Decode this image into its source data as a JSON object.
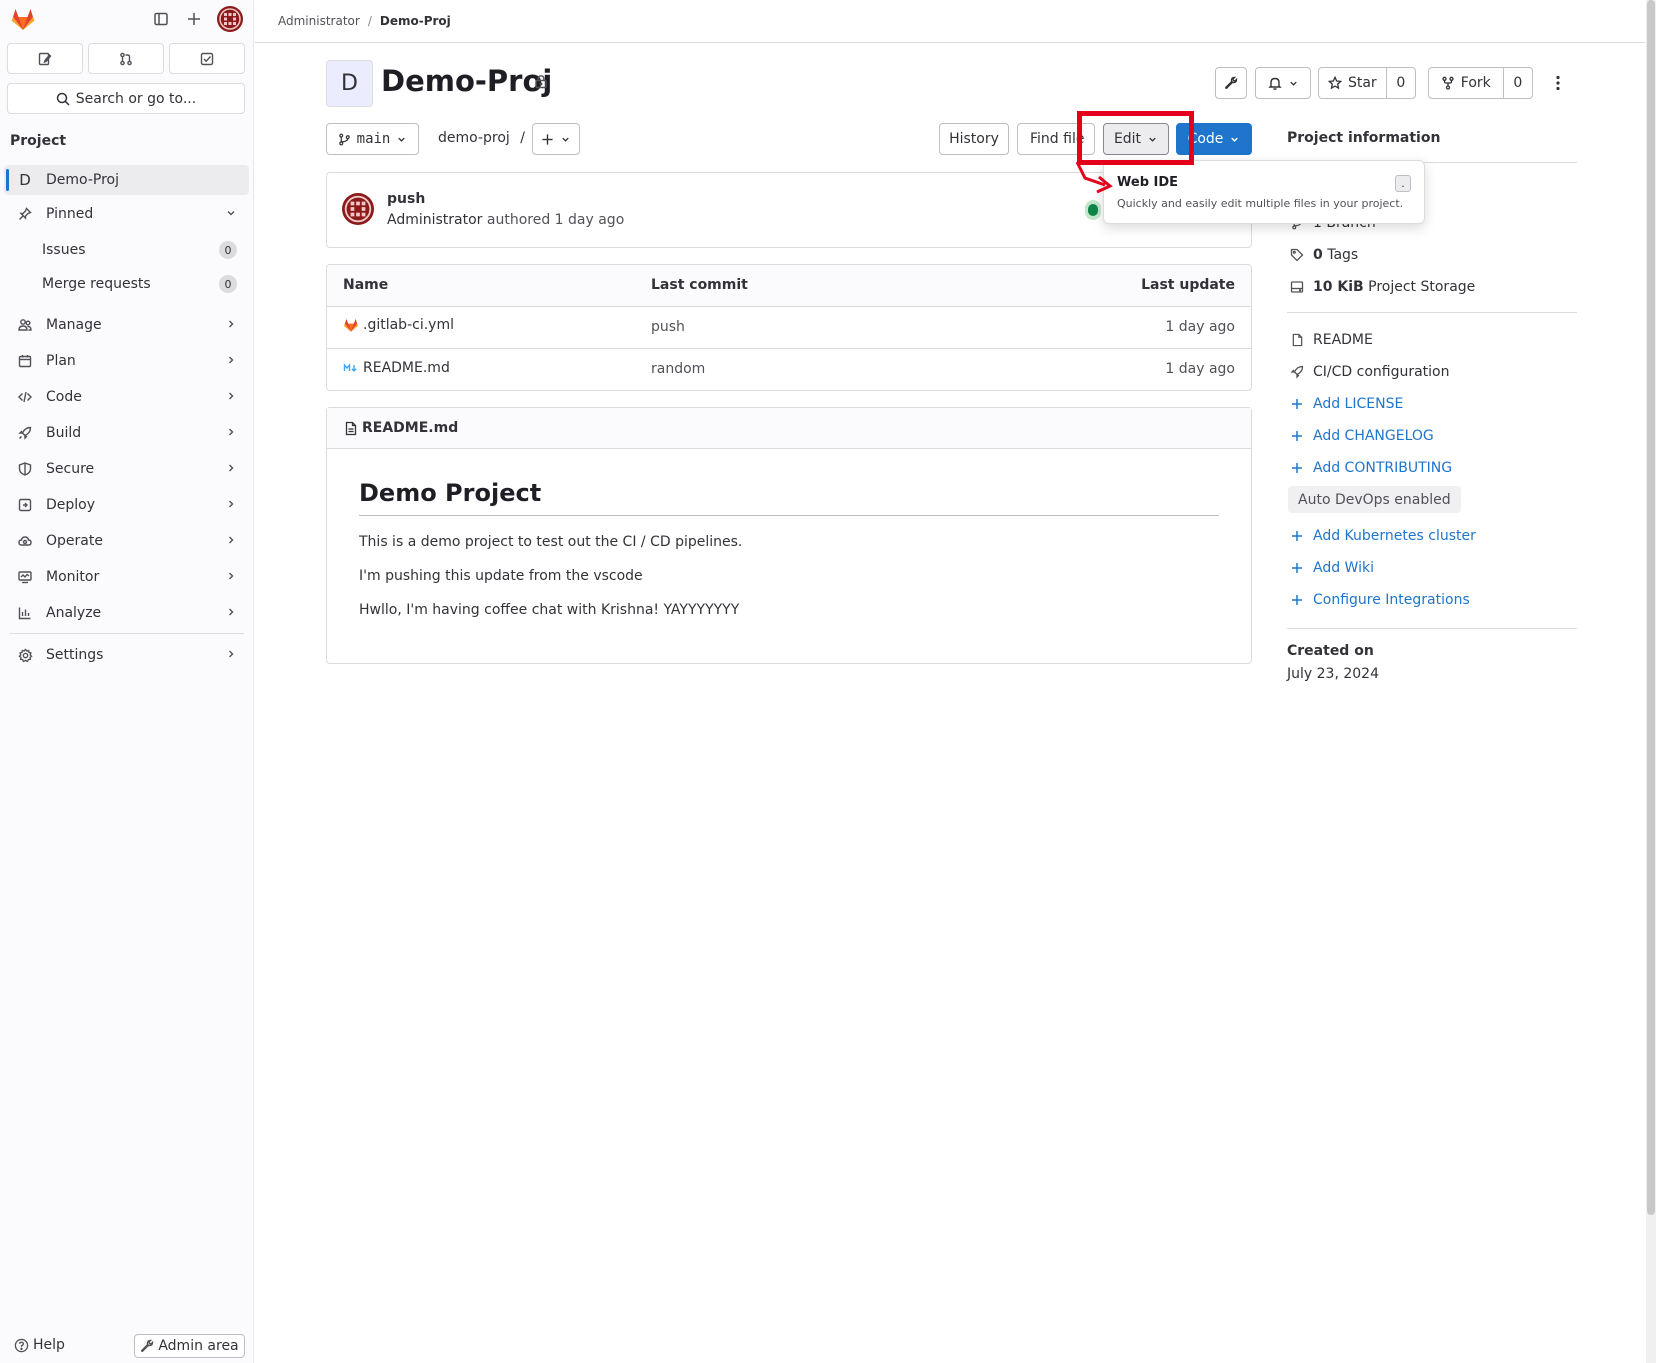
{
  "sidebar": {
    "search_placeholder": "Search or go to...",
    "section_heading": "Project",
    "project_item": {
      "initial": "D",
      "label": "Demo-Proj"
    },
    "pinned": {
      "label": "Pinned",
      "items": [
        {
          "label": "Issues",
          "count": "0"
        },
        {
          "label": "Merge requests",
          "count": "0"
        }
      ]
    },
    "items": [
      {
        "label": "Manage"
      },
      {
        "label": "Plan"
      },
      {
        "label": "Code"
      },
      {
        "label": "Build"
      },
      {
        "label": "Secure"
      },
      {
        "label": "Deploy"
      },
      {
        "label": "Operate"
      },
      {
        "label": "Monitor"
      },
      {
        "label": "Analyze"
      }
    ],
    "settings_label": "Settings",
    "help_label": "Help",
    "admin_label": "Admin area"
  },
  "breadcrumb": {
    "parent": "Administrator",
    "separator": "/",
    "current": "Demo-Proj"
  },
  "project": {
    "initial": "D",
    "name": "Demo-Proj"
  },
  "actions": {
    "star_label": "Star",
    "star_count": "0",
    "fork_label": "Fork",
    "fork_count": "0"
  },
  "repo_bar": {
    "branch": "main",
    "path": "demo-proj",
    "path_sep": "/",
    "history_label": "History",
    "find_file_label": "Find file",
    "edit_label": "Edit",
    "code_label": "Code"
  },
  "edit_dropdown": {
    "title": "Web IDE",
    "description": "Quickly and easily edit multiple files in your project.",
    "shortcut": "."
  },
  "commit": {
    "message": "push",
    "author": "Administrator",
    "authored_text": "authored",
    "time": "1 day ago"
  },
  "files": {
    "headers": [
      "Name",
      "Last commit",
      "Last update"
    ],
    "rows": [
      {
        "name": ".gitlab-ci.yml",
        "commit": "push",
        "updated": "1 day ago"
      },
      {
        "name": "README.md",
        "commit": "random",
        "updated": "1 day ago"
      }
    ]
  },
  "readme": {
    "filename": "README.md",
    "heading": "Demo Project",
    "paragraphs": [
      "This is a demo project to test out the CI / CD pipelines.",
      "I'm pushing this update from the vscode",
      "Hwllo, I'm having coffee chat with Krishna! YAYYYYYYY"
    ]
  },
  "project_info": {
    "title": "Project information",
    "branch_text": "1 Branch",
    "tags_count": "0",
    "tags_label": "Tags",
    "storage_size": "10 KiB",
    "storage_label": "Project Storage",
    "readme_label": "README",
    "cicd_label": "CI/CD configuration",
    "add_license": "Add LICENSE",
    "add_changelog": "Add CHANGELOG",
    "add_contributing": "Add CONTRIBUTING",
    "auto_devops": "Auto DevOps enabled",
    "add_k8s": "Add Kubernetes cluster",
    "add_wiki": "Add Wiki",
    "configure_integrations": "Configure Integrations",
    "created_label": "Created on",
    "created_date": "July 23, 2024"
  },
  "colors": {
    "accent": "#1f75cb",
    "highlight": "#e4001b",
    "brand": "#e24329"
  }
}
